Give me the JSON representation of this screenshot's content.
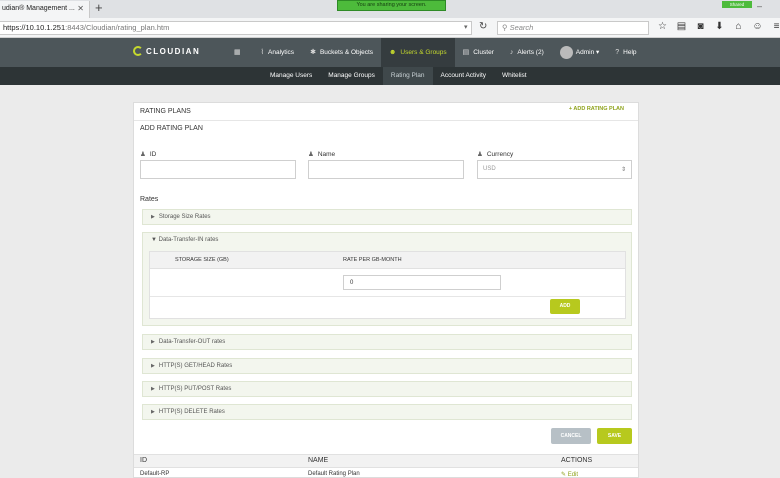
{
  "browser": {
    "tab_title": "udian® Management ...",
    "url_host": "https://10.10.1.251",
    "url_path": ":8443/Cloudian/rating_plan.htm",
    "search_placeholder": "Search",
    "share_banner": "You are sharing your screen.",
    "shared_badge": "Shared"
  },
  "app": {
    "logo": "CLOUDIAN",
    "nav": [
      {
        "label": "",
        "icon": "grid-icon"
      },
      {
        "label": "Analytics",
        "icon": "analytics-icon"
      },
      {
        "label": "Buckets & Objects",
        "icon": "buckets-icon"
      },
      {
        "label": "Users & Groups",
        "icon": "users-icon",
        "active": true
      },
      {
        "label": "Cluster",
        "icon": "cluster-icon"
      },
      {
        "label": "Alerts (2)",
        "icon": "bell-icon"
      },
      {
        "label": "Admin ▾",
        "icon": "avatar"
      },
      {
        "label": "Help",
        "icon": "help-icon"
      }
    ],
    "subnav": [
      "Manage Users",
      "Manage Groups",
      "Rating Plan",
      "Account Activity",
      "Whitelist"
    ],
    "subnav_active": "Rating Plan"
  },
  "panel": {
    "title": "RATING PLANS",
    "add_link": "+ ADD RATING PLAN",
    "subtitle": "ADD RATING PLAN",
    "id_label": "ID",
    "name_label": "Name",
    "currency_label": "Currency",
    "currency_value": "USD",
    "rates_title": "Rates",
    "sections": {
      "storage": "Storage Size Rates",
      "transfer_in": "Data-Transfer-IN rates",
      "transfer_out": "Data-Transfer-OUT rates",
      "get_head": "HTTP(S) GET/HEAD Rates",
      "put_post": "HTTP(S) PUT/POST Rates",
      "delete": "HTTP(S) DELETE Rates"
    },
    "inner_table": {
      "col_size": "STORAGE SIZE (GB)",
      "col_rate": "RATE PER GB-MONTH",
      "rate_value": "0",
      "add_button": "ADD"
    },
    "cancel_button": "CANCEL",
    "save_button": "SAVE",
    "plans_table": {
      "headers": [
        "ID",
        "NAME",
        "ACTIONS"
      ],
      "rows": [
        {
          "id": "Default-RP",
          "name": "Default Rating Plan",
          "action": "✎ Edit"
        }
      ]
    }
  },
  "colors": {
    "accent": "#b7c91e",
    "nav_bg": "#4d565a",
    "subnav_bg": "#2d3436"
  }
}
